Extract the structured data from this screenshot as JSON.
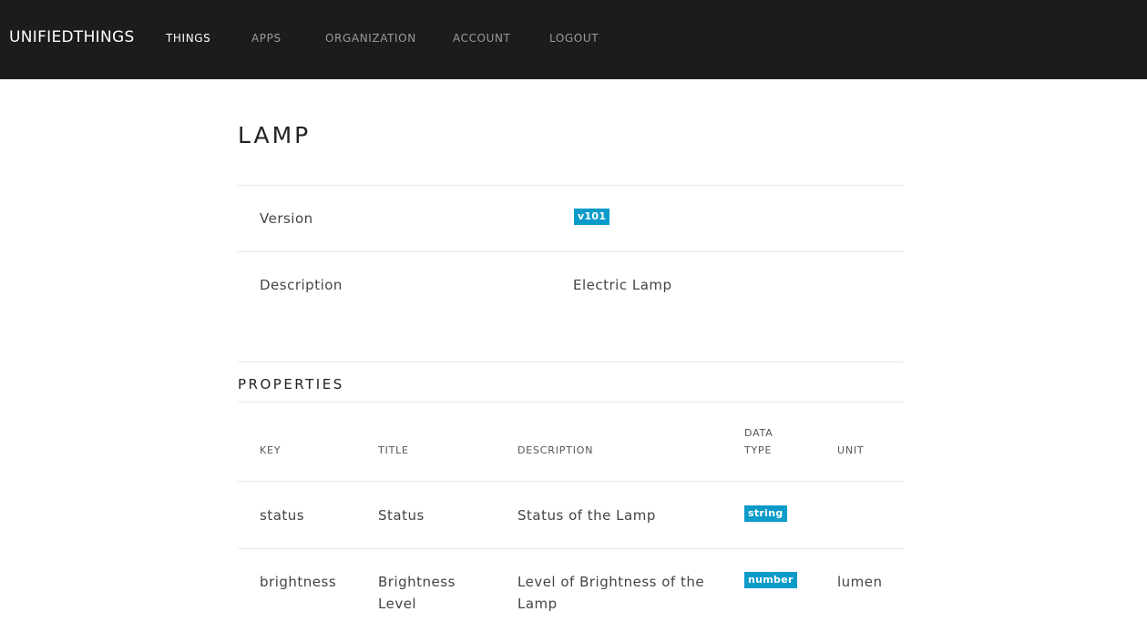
{
  "nav": {
    "brand": "UNIFIEDTHINGS",
    "links": [
      "THINGS",
      "APPS",
      "ORGANIZATION",
      "ACCOUNT",
      "LOGOUT"
    ]
  },
  "page": {
    "title": "LAMP"
  },
  "details": {
    "version_label": "Version",
    "version_value": "v101",
    "description_label": "Description",
    "description_value": "Electric Lamp"
  },
  "properties": {
    "title": "PROPERTIES",
    "headers": {
      "key": "KEY",
      "title": "TITLE",
      "description": "DESCRIPTION",
      "data_type": "DATA TYPE",
      "unit": "UNIT"
    },
    "rows": [
      {
        "key": "status",
        "title": "Status",
        "description": "Status of the Lamp",
        "data_type": "string",
        "unit": ""
      },
      {
        "key": "brightness",
        "title": "Brightness Level",
        "description": "Level of Brightness of the Lamp",
        "data_type": "number",
        "unit": "lumen"
      }
    ]
  },
  "colors": {
    "topbar": "#1c1c1c",
    "badge": "#0b9bc9"
  }
}
